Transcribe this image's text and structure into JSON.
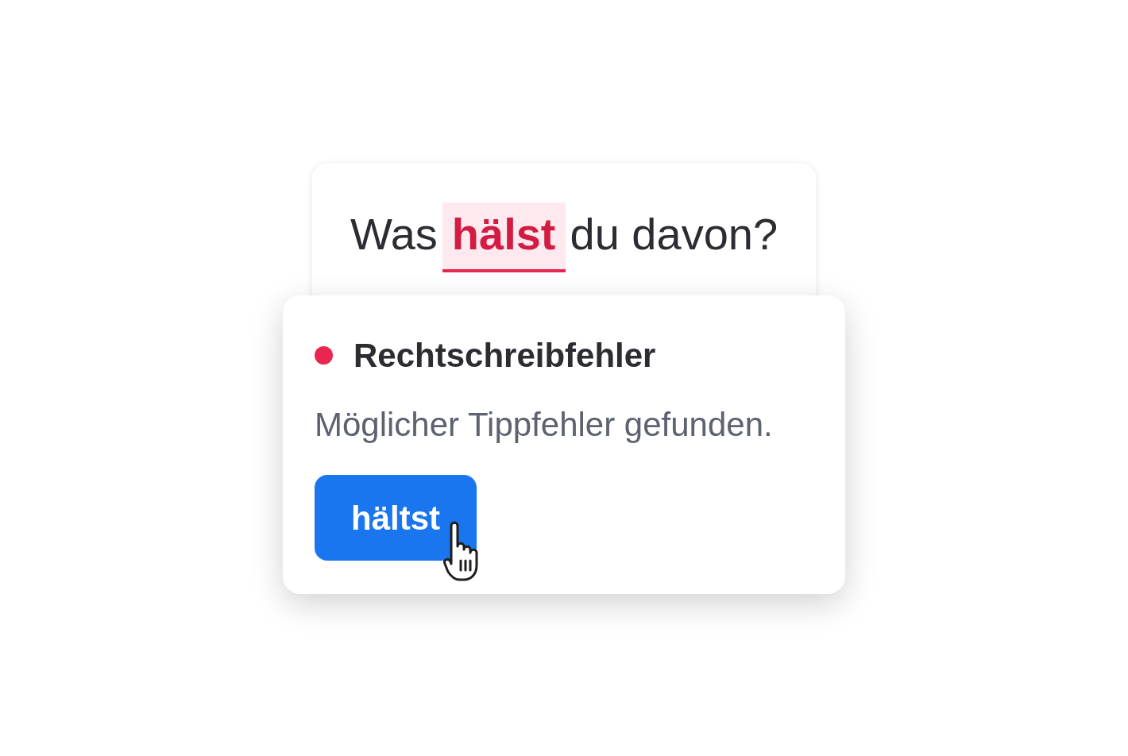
{
  "sentence": [
    {
      "text": "Was",
      "flagged": false
    },
    {
      "text": "hälst",
      "flagged": true
    },
    {
      "text": "du davon?",
      "flagged": false
    }
  ],
  "popup": {
    "issue": {
      "title": "Rechtschreibfehler",
      "color": "#e8264f"
    },
    "message": "Möglicher Tippfehler gefunden.",
    "suggestion": "hältst"
  }
}
